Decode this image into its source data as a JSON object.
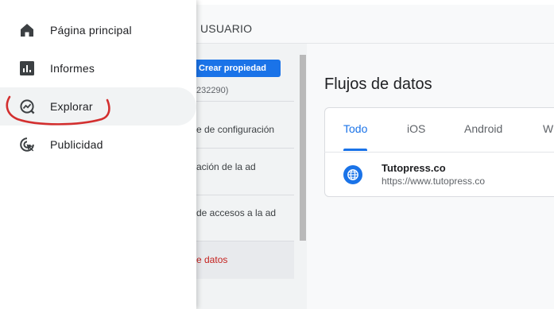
{
  "header": {
    "title": "USUARIO"
  },
  "nav": {
    "items": [
      {
        "label": "Página principal",
        "icon": "home-icon"
      },
      {
        "label": "Informes",
        "icon": "bar-chart-icon"
      },
      {
        "label": "Explorar",
        "icon": "explore-icon"
      },
      {
        "label": "Publicidad",
        "icon": "advertising-icon"
      }
    ]
  },
  "admin": {
    "create_button": "Crear propiedad",
    "property_id": "232290)",
    "items": [
      {
        "label": "e de configuración"
      },
      {
        "label": "ación de la ad"
      },
      {
        "label": "de accesos a la ad"
      },
      {
        "label": "e datos"
      }
    ]
  },
  "streams": {
    "title": "Flujos de datos",
    "tabs": [
      "Todo",
      "iOS",
      "Android",
      "W"
    ],
    "active_tab": "Todo",
    "stream": {
      "name": "Tutopress.co",
      "url": "https://www.tutopress.co"
    }
  },
  "colors": {
    "accent": "#1a73e8",
    "annotation": "#d32f2f",
    "active_text": "#c5221f"
  }
}
